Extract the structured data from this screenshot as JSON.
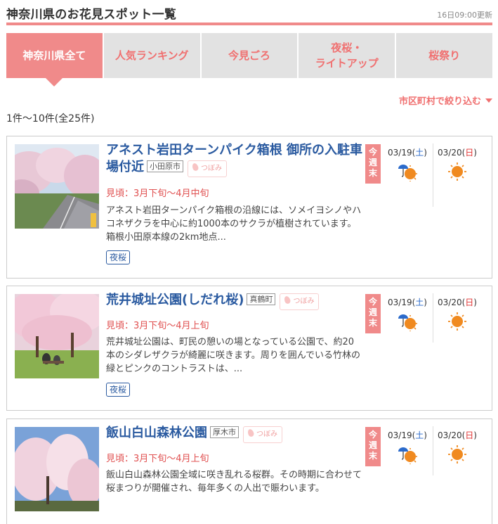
{
  "header": {
    "title": "神奈川県のお花見スポット一覧",
    "updated": "16日09:00更新"
  },
  "tabs": [
    {
      "label": "神奈川県全て",
      "active": true
    },
    {
      "label": "人気ランキング"
    },
    {
      "label": "今見ごろ"
    },
    {
      "label": "夜桜・\nライトアップ"
    },
    {
      "label": "桜祭り"
    }
  ],
  "filter_label": "市区町村で絞り込む",
  "count_label": "1件～10件(全25件)",
  "weekend_label": "今週末",
  "colors": {
    "accent": "#f08a8a",
    "link": "#2a5aa0",
    "season": "#e05050"
  },
  "spots": [
    {
      "name": "アネスト岩田ターンパイク箱根 御所の入駐車場付近",
      "city": "小田原市",
      "status": "つぼみ",
      "season": "見頃：3月下旬～4月中旬",
      "description": "アネスト岩田ターンパイク箱根の沿線には、ソメイヨシノやハコネザクラを中心に約1000本のサクラが植樹されています。箱根小田原本線の2km地点...",
      "tag": "夜桜",
      "weather": [
        {
          "date": "03/19",
          "dow": "土",
          "icon": "rain-then-sun-icon"
        },
        {
          "date": "03/20",
          "dow": "日",
          "icon": "sun-icon"
        }
      ]
    },
    {
      "name": "荒井城址公園(しだれ桜)",
      "city": "真鶴町",
      "status": "つぼみ",
      "season": "見頃：3月下旬～4月上旬",
      "description": "荒井城址公園は、町民の憩いの場となっている公園で、約20本のシダレザクラが綺麗に咲きます。周りを囲んでいる竹林の緑とピンクのコントラストは、...",
      "tag": "夜桜",
      "weather": [
        {
          "date": "03/19",
          "dow": "土",
          "icon": "rain-then-sun-icon"
        },
        {
          "date": "03/20",
          "dow": "日",
          "icon": "sun-icon"
        }
      ]
    },
    {
      "name": "飯山白山森林公園",
      "city": "厚木市",
      "status": "つぼみ",
      "season": "見頃：3月下旬～4月上旬",
      "description": "飯山白山森林公園全域に咲き乱れる桜群。その時期に合わせて桜まつりが開催され、毎年多くの人出で賑わいます。",
      "weather": [
        {
          "date": "03/19",
          "dow": "土",
          "icon": "rain-then-sun-icon"
        },
        {
          "date": "03/20",
          "dow": "日",
          "icon": "sun-icon"
        }
      ]
    }
  ]
}
